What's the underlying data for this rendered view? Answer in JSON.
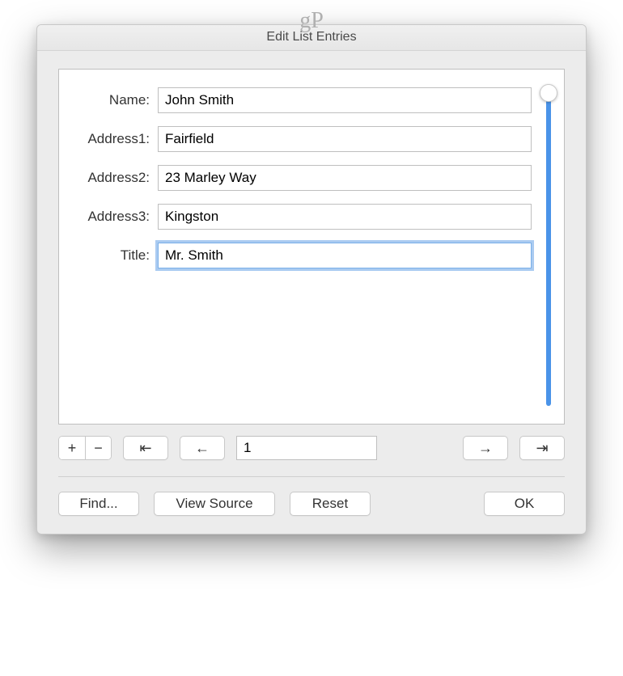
{
  "watermark": "gP",
  "dialog": {
    "title": "Edit List Entries"
  },
  "fields": [
    {
      "label": "Name:",
      "value": "John Smith",
      "focused": false
    },
    {
      "label": "Address1:",
      "value": "Fairfield",
      "focused": false
    },
    {
      "label": "Address2:",
      "value": "23 Marley Way",
      "focused": false
    },
    {
      "label": "Address3:",
      "value": "Kingston",
      "focused": false
    },
    {
      "label": "Title:",
      "value": "Mr. Smith",
      "focused": true
    }
  ],
  "nav": {
    "plus": "+",
    "minus": "−",
    "first": "⇤",
    "prev": "←",
    "record": "1",
    "next": "→",
    "last": "⇥"
  },
  "buttons": {
    "find": "Find...",
    "viewSource": "View Source",
    "reset": "Reset",
    "ok": "OK"
  }
}
